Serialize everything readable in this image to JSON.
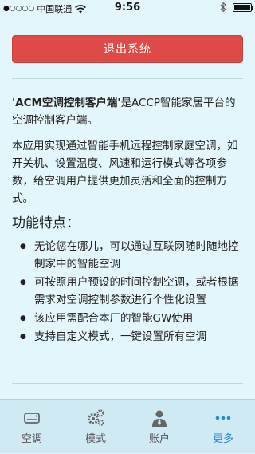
{
  "status_bar": {
    "signal_dots": "●○○○○",
    "carrier": "中国联通",
    "time": "9:56"
  },
  "logout_button": {
    "label": "退出系统"
  },
  "about": {
    "intro_bold": "'ACM空调控制客户端'",
    "intro_rest": "是ACCP智能家居平台的空调控制客户端。",
    "description": "本应用实现通过智能手机远程控制家庭空调，如开关机、设置温度、风速和运行模式等各项参数，给空调用户提供更加灵活和全面的控制方式。",
    "features_title": "功能特点：",
    "features": [
      "无论您在哪儿，可以通过互联网随时随地控制家中的智能空调",
      "可按照用户预设的时间控制空调，或者根据需求对空调控制参数进行个性化设置",
      "该应用需配合本厂的智能GW使用",
      "支持自定义模式，一键设置所有空调"
    ]
  },
  "tabbar": {
    "tabs": [
      {
        "label": "空调",
        "icon": "air-conditioner-icon",
        "active": false
      },
      {
        "label": "模式",
        "icon": "gears-icon",
        "active": false
      },
      {
        "label": "账户",
        "icon": "user-tie-icon",
        "active": false
      },
      {
        "label": "更多",
        "icon": "more-dots-icon",
        "active": true
      }
    ]
  },
  "colors": {
    "background": "#e3f6fb",
    "logout_button": "#dd4a48",
    "active_tab": "#2a86d6",
    "inactive_tab": "#555555"
  }
}
